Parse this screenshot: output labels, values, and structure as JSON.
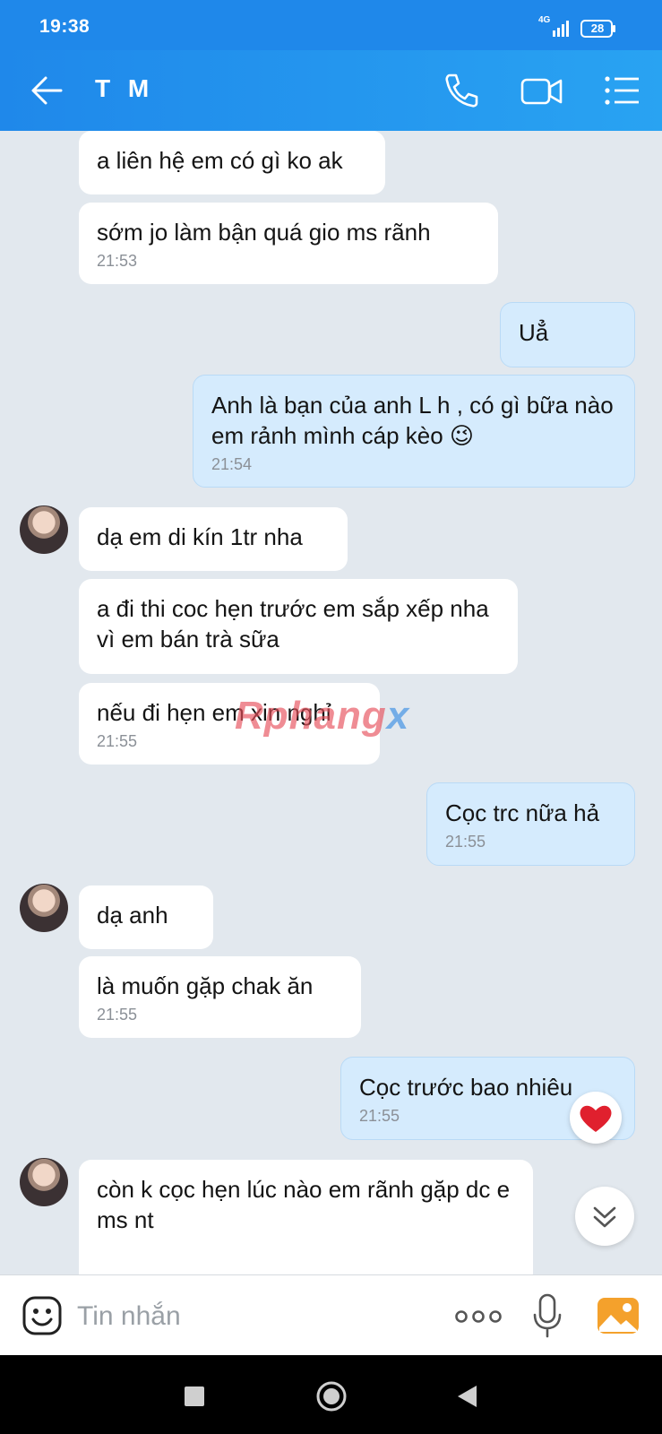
{
  "status_bar": {
    "time": "19:38",
    "network": "4G",
    "battery": "28"
  },
  "header": {
    "title": "T M",
    "back_icon": "back-arrow-icon",
    "call_icon": "phone-icon",
    "video_icon": "video-camera-icon",
    "menu_icon": "list-menu-icon"
  },
  "messages": [
    {
      "text": "a liên hệ em có gì ko ak",
      "time": ""
    },
    {
      "text": "sớm jo làm bận quá gio ms rãnh",
      "time": "21:53"
    },
    {
      "text": "Uẳ",
      "time": ""
    },
    {
      "text": "Anh là bạn của anh L h , có gì bữa nào em rảnh mình cáp kèo 😉",
      "time": "21:54"
    },
    {
      "text": "dạ em di kín 1tr nha",
      "time": ""
    },
    {
      "text": "a đi thi coc hẹn trước em sắp xếp nha vì em bán trà sữa",
      "time": ""
    },
    {
      "text": "nếu đi hẹn em xin nghỉ",
      "time": "21:55"
    },
    {
      "text": "Cọc trc nữa hả",
      "time": "21:55"
    },
    {
      "text": "dạ anh",
      "time": ""
    },
    {
      "text": "là muốn gặp chak ăn",
      "time": "21:55"
    },
    {
      "text": "Cọc trước bao nhiêu",
      "time": "21:55"
    },
    {
      "text": "còn k cọc hẹn lúc nào em rãnh gặp dc e ms nt",
      "time": ""
    }
  ],
  "watermark": {
    "part1": "Rphang",
    "part2": "x"
  },
  "input_bar": {
    "placeholder": "Tin nhắn",
    "emoji_icon": "emoji-icon",
    "more_icon": "more-dots-icon",
    "mic_icon": "microphone-icon",
    "image_icon": "image-icon"
  },
  "colors": {
    "header": "#1f88ea",
    "incoming": "#ffffff",
    "outgoing": "#d5ebfd",
    "background": "#e2e8ee",
    "heart": "#e0202e"
  }
}
